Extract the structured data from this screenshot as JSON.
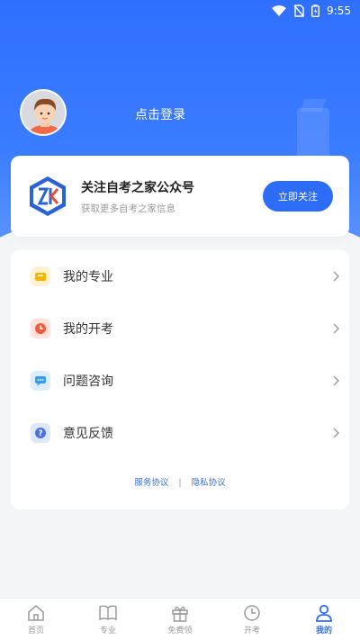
{
  "status_bar": {
    "time": "9:55"
  },
  "profile": {
    "login_text": "点击登录"
  },
  "follow_card": {
    "title": "关注自考之家公众号",
    "subtitle": "获取更多自考之家信息",
    "button_label": "立即关注"
  },
  "menu": {
    "items": [
      {
        "label": "我的专业",
        "icon": "folder-icon",
        "color": "#f7b500"
      },
      {
        "label": "我的开考",
        "icon": "clock-icon",
        "color": "#f25c3c"
      },
      {
        "label": "问题咨询",
        "icon": "chat-icon",
        "color": "#3a9cf0"
      },
      {
        "label": "意见反馈",
        "icon": "help-icon",
        "color": "#4a72e8"
      }
    ],
    "service_link": "服务协议",
    "separator": "|",
    "privacy_link": "隐私协议"
  },
  "tabbar": {
    "tabs": [
      {
        "label": "首页"
      },
      {
        "label": "专业"
      },
      {
        "label": "免费领"
      },
      {
        "label": "开考"
      },
      {
        "label": "我的"
      }
    ],
    "active": "我的"
  },
  "colors": {
    "primary": "#2d6cf6",
    "hero": "#3a7cff"
  }
}
